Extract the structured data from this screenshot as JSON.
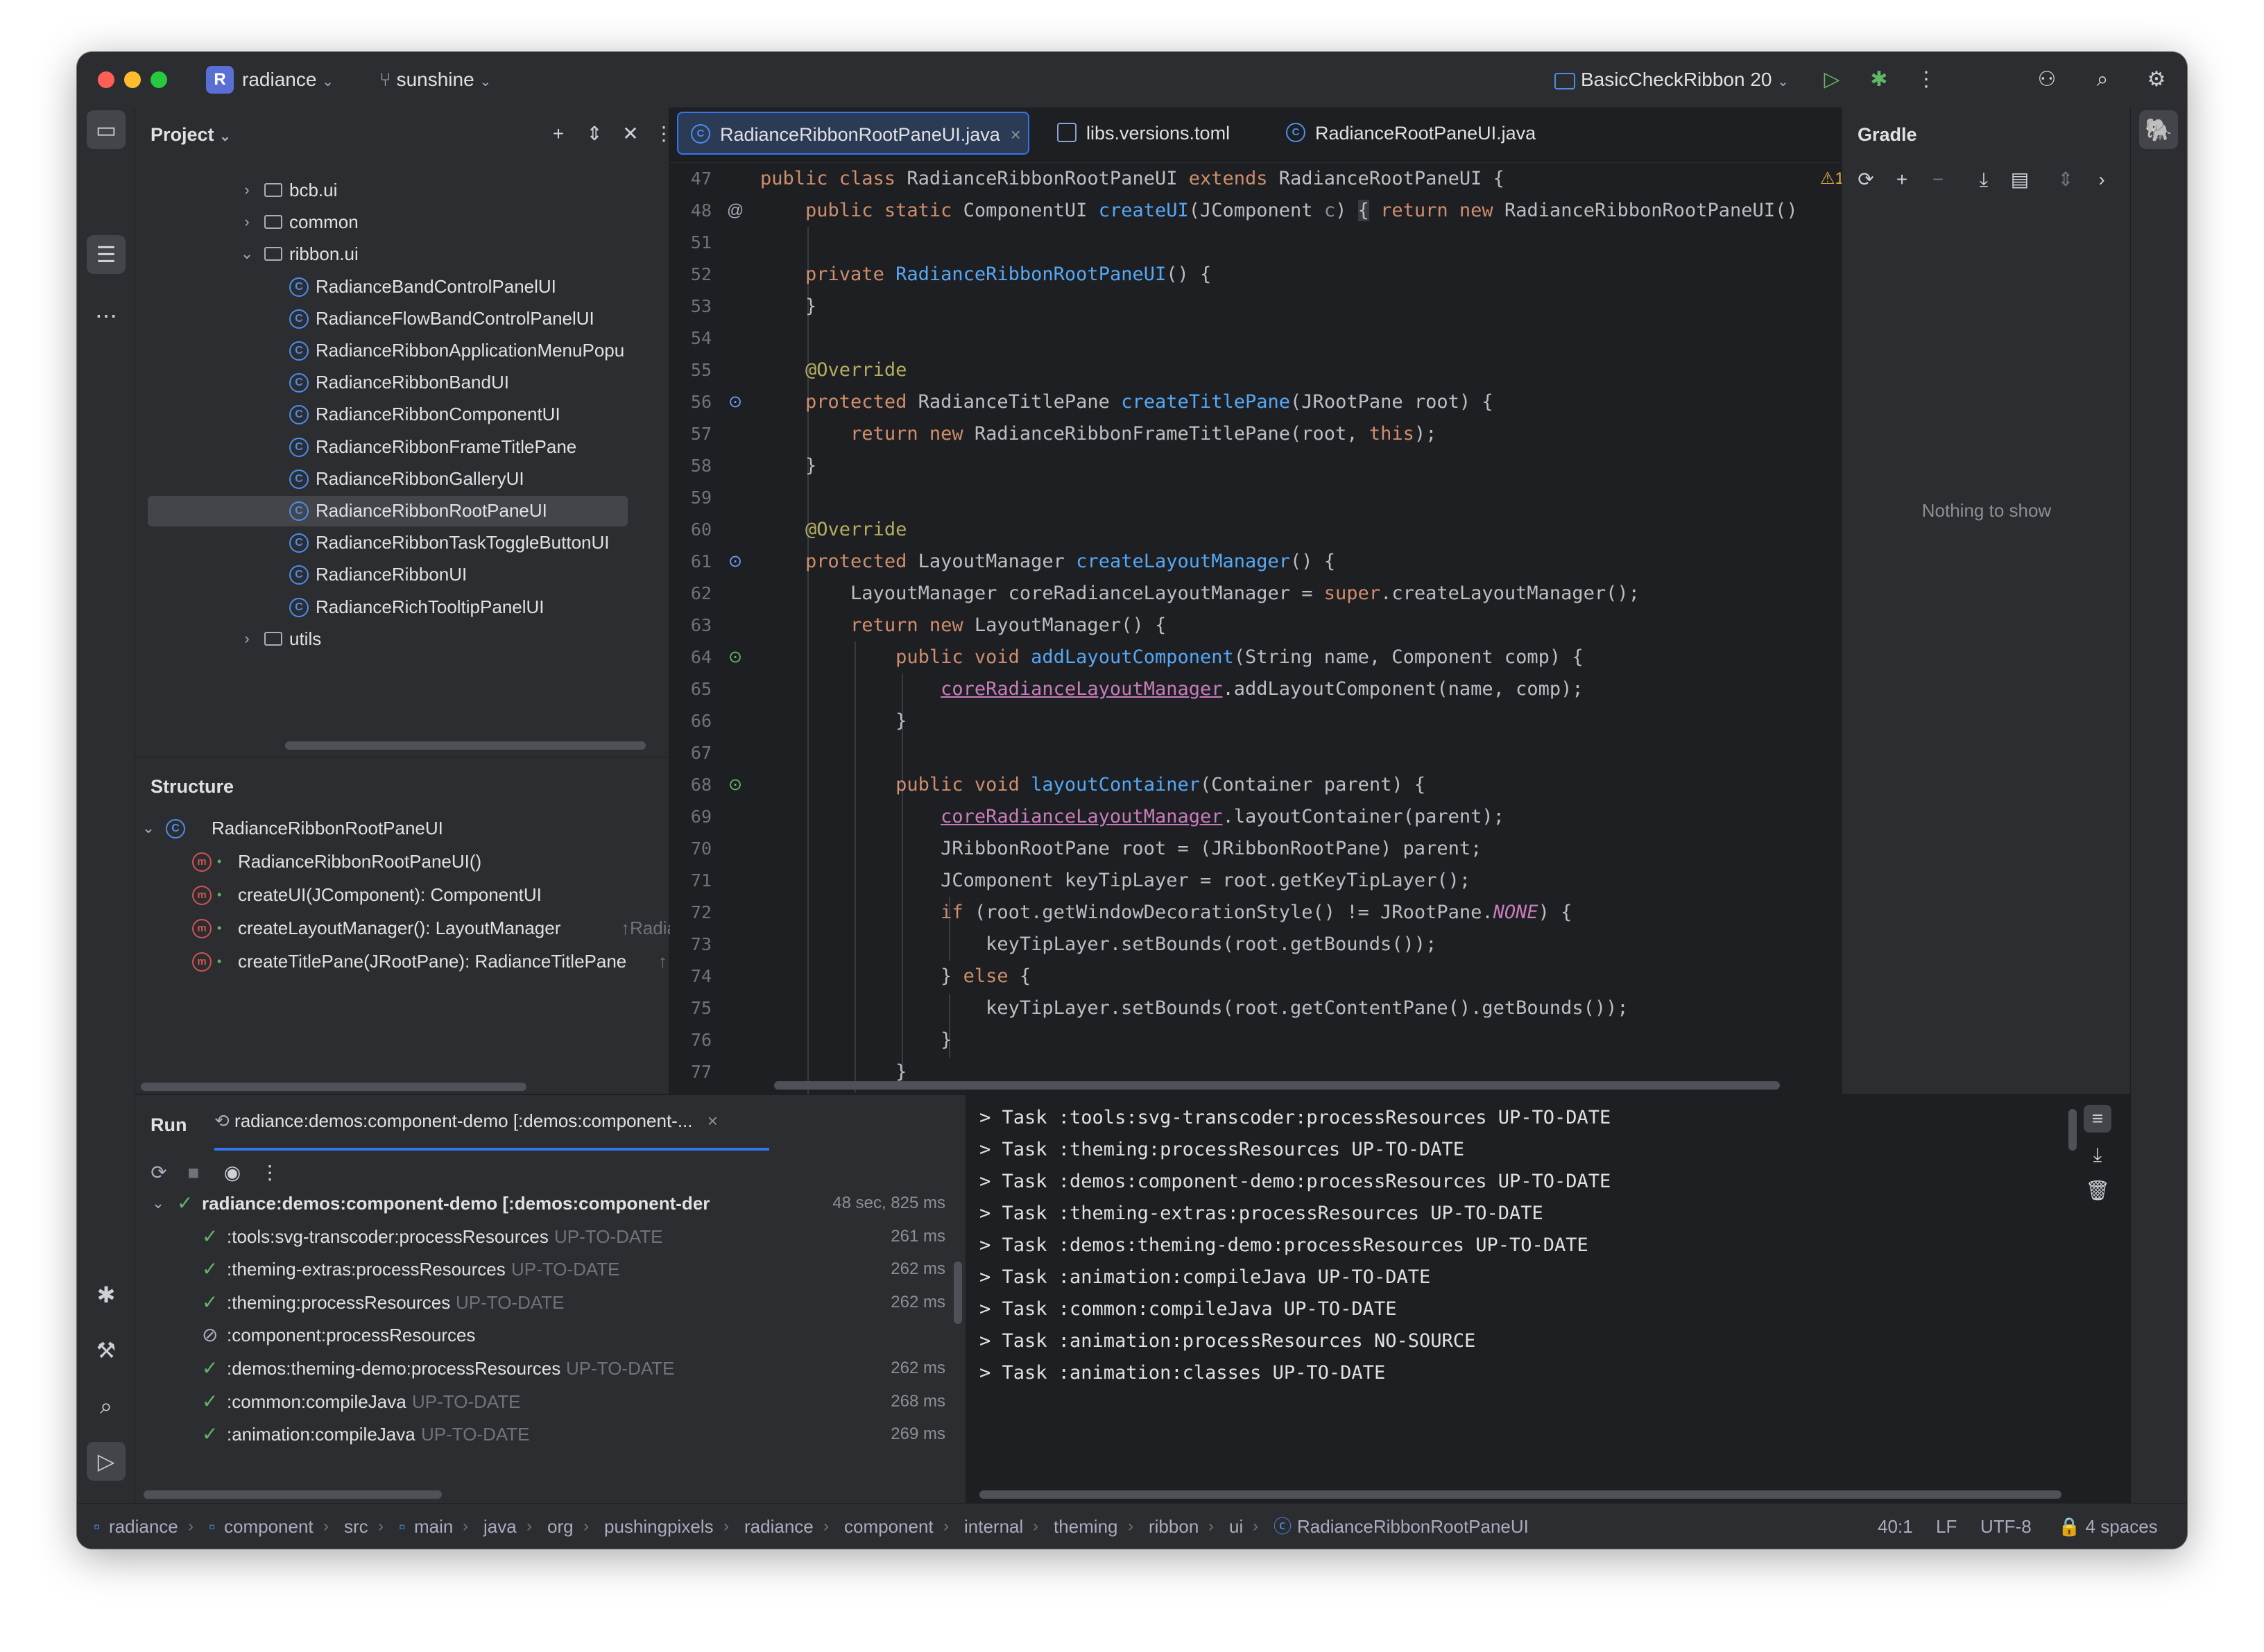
{
  "titlebar": {
    "project_badge": "R",
    "project_name": "radiance",
    "branch": "sunshine",
    "run_config": "BasicCheckRibbon 20"
  },
  "project_panel": {
    "title": "Project",
    "tree": [
      {
        "label": "bcb.ui",
        "kind": "folder",
        "state": "collapsed"
      },
      {
        "label": "common",
        "kind": "folder",
        "state": "collapsed"
      },
      {
        "label": "ribbon.ui",
        "kind": "folder",
        "state": "expanded"
      },
      {
        "label": "RadianceBandControlPanelUI",
        "kind": "class"
      },
      {
        "label": "RadianceFlowBandControlPanelUI",
        "kind": "class"
      },
      {
        "label": "RadianceRibbonApplicationMenuPopu",
        "kind": "class"
      },
      {
        "label": "RadianceRibbonBandUI",
        "kind": "class"
      },
      {
        "label": "RadianceRibbonComponentUI",
        "kind": "class"
      },
      {
        "label": "RadianceRibbonFrameTitlePane",
        "kind": "class"
      },
      {
        "label": "RadianceRibbonGalleryUI",
        "kind": "class"
      },
      {
        "label": "RadianceRibbonRootPaneUI",
        "kind": "class",
        "selected": true
      },
      {
        "label": "RadianceRibbonTaskToggleButtonUI",
        "kind": "class"
      },
      {
        "label": "RadianceRibbonUI",
        "kind": "class"
      },
      {
        "label": "RadianceRichTooltipPanelUI",
        "kind": "class"
      },
      {
        "label": "utils",
        "kind": "folder",
        "state": "collapsed"
      }
    ]
  },
  "structure_panel": {
    "title": "Structure",
    "root": "RadianceRibbonRootPaneUI",
    "members": [
      {
        "label": "RadianceRibbonRootPaneUI()",
        "suffix": ""
      },
      {
        "label": "createUI(JComponent): ComponentUI",
        "suffix": ""
      },
      {
        "label": "createLayoutManager(): LayoutManager",
        "suffix": "↑Radianc"
      },
      {
        "label": "createTitlePane(JRootPane): RadianceTitlePane",
        "suffix": "↑"
      }
    ]
  },
  "editor": {
    "tabs": [
      {
        "label": "RadianceRibbonRootPaneUI.java",
        "active": true
      },
      {
        "label": "libs.versions.toml",
        "active": false
      },
      {
        "label": "RadianceRootPaneUI.java",
        "active": false
      }
    ],
    "warning_count": "1",
    "line_numbers": [
      "47",
      "48",
      "51",
      "52",
      "53",
      "54",
      "55",
      "56",
      "57",
      "58",
      "59",
      "60",
      "61",
      "62",
      "63",
      "64",
      "65",
      "66",
      "67",
      "68",
      "69",
      "70",
      "71",
      "72",
      "73",
      "74",
      "75",
      "76",
      "77"
    ]
  },
  "gradle_panel": {
    "title": "Gradle",
    "empty_text": "Nothing to show"
  },
  "run_panel": {
    "title": "Run",
    "tab_label": "radiance:demos:component-demo [:demos:component-...",
    "tasks": [
      {
        "label": "radiance:demos:component-demo [:demos:component-der",
        "status": "",
        "duration": "48 sec, 825 ms",
        "icon": "check",
        "root": true
      },
      {
        "label": ":tools:svg-transcoder:processResources",
        "status": "UP-TO-DATE",
        "duration": "261 ms",
        "icon": "check"
      },
      {
        "label": ":theming-extras:processResources",
        "status": "UP-TO-DATE",
        "duration": "262 ms",
        "icon": "check"
      },
      {
        "label": ":theming:processResources",
        "status": "UP-TO-DATE",
        "duration": "262 ms",
        "icon": "check"
      },
      {
        "label": ":component:processResources",
        "status": "",
        "duration": "",
        "icon": "skip"
      },
      {
        "label": ":demos:theming-demo:processResources",
        "status": "UP-TO-DATE",
        "duration": "262 ms",
        "icon": "check"
      },
      {
        "label": ":common:compileJava",
        "status": "UP-TO-DATE",
        "duration": "268 ms",
        "icon": "check"
      },
      {
        "label": ":animation:compileJava",
        "status": "UP-TO-DATE",
        "duration": "269 ms",
        "icon": "check"
      }
    ],
    "console": [
      "> Task :tools:svg-transcoder:processResources UP-TO-DATE",
      "> Task :theming:processResources UP-TO-DATE",
      "> Task :demos:component-demo:processResources UP-TO-DATE",
      "> Task :theming-extras:processResources UP-TO-DATE",
      "> Task :demos:theming-demo:processResources UP-TO-DATE",
      "> Task :animation:compileJava UP-TO-DATE",
      "> Task :common:compileJava UP-TO-DATE",
      "> Task :animation:processResources NO-SOURCE",
      "> Task :animation:classes UP-TO-DATE"
    ]
  },
  "statusbar": {
    "breadcrumbs": [
      "radiance",
      "component",
      "src",
      "main",
      "java",
      "org",
      "pushingpixels",
      "radiance",
      "component",
      "internal",
      "theming",
      "ribbon",
      "ui",
      "RadianceRibbonRootPaneUI"
    ],
    "position": "40:1",
    "line_ending": "LF",
    "encoding": "UTF-8",
    "indent": "4 spaces"
  }
}
